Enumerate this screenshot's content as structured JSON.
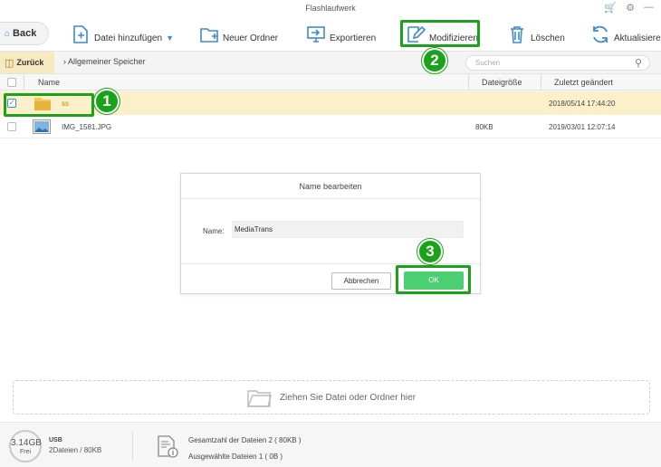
{
  "window": {
    "title": "Flashlaufwerk"
  },
  "toolbar": {
    "back": "Back",
    "add_file": "Datei hinzufügen",
    "new_folder": "Neuer Ordner",
    "export": "Exportieren",
    "modify": "Modifizieren",
    "delete": "Löschen",
    "refresh": "Aktualisieren"
  },
  "nav": {
    "back": "Zurück",
    "breadcrumb": "Allgemeiner Speicher",
    "search_placeholder": "Suchen"
  },
  "table": {
    "headers": {
      "name": "Name",
      "size": "Dateigröße",
      "modified": "Zuletzt geändert"
    },
    "rows": [
      {
        "name": "ss",
        "size": "",
        "modified": "2018/05/14 17:44:20",
        "selected": true,
        "icon": "folder-icon"
      },
      {
        "name": "IMG_1581.JPG",
        "size": "80KB",
        "modified": "2019/03/01 12:07:14",
        "selected": false,
        "icon": "image-icon"
      }
    ]
  },
  "dialog": {
    "title": "Name bearbeiten",
    "name_label": "Name:",
    "name_value": "MediaTrans",
    "cancel": "Abbrechen",
    "ok": "OK"
  },
  "dropzone": {
    "text": "Ziehen Sie Datei oder Ordner hier"
  },
  "status": {
    "free_size": "3.14GB",
    "free_label": "Frei",
    "device": "USB",
    "device_info": "2Dateien / 80KB",
    "total": "Gesamtzahl der Dateien 2 ( 80KB )",
    "selected": "Ausgewählte Dateien 1 ( 0B )"
  },
  "annotations": [
    "1",
    "2",
    "3"
  ],
  "colors": {
    "highlight": "#1ba21b",
    "ok_button": "#4ccf73",
    "selected_row": "#fbf0c9",
    "accent_blue": "#3a8bd4"
  }
}
